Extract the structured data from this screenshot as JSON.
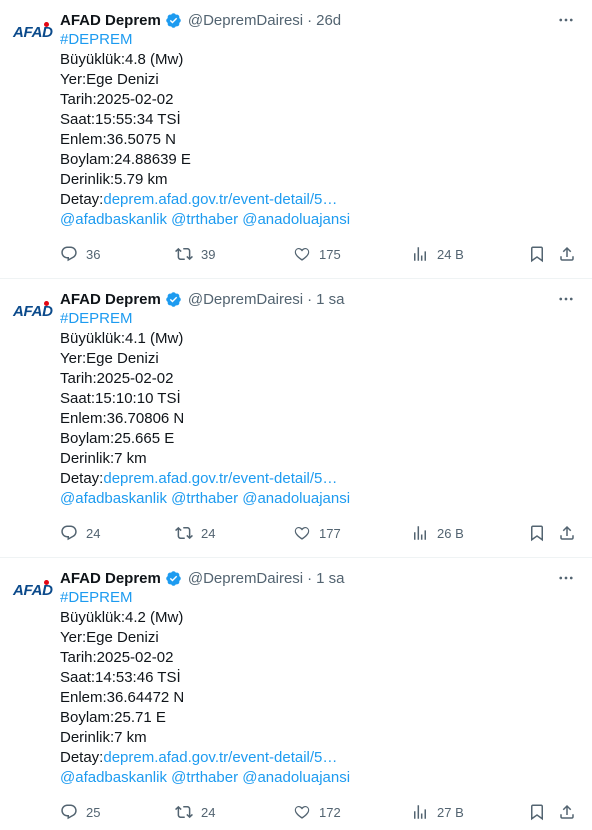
{
  "colors": {
    "link": "#1d9bf0",
    "muted": "#536471",
    "text": "#0f1419",
    "verified": "#1d9bf0",
    "logo_blue": "#0b4a8b",
    "logo_red": "#e30613"
  },
  "tweets": [
    {
      "avatar": "AFAD",
      "name": "AFAD Deprem",
      "handle": "@DepremDairesi",
      "sep": "·",
      "time": "26d",
      "hashtag": "#DEPREM",
      "lines": [
        "Büyüklük:4.8 (Mw)",
        "Yer:Ege Denizi",
        "Tarih:2025-02-02",
        "Saat:15:55:34 TSİ",
        "Enlem:36.5075 N",
        "Boylam:24.88639 E",
        "Derinlik:5.79 km"
      ],
      "detail_label": "Detay:",
      "detail_link": "deprem.afad.gov.tr/event-detail/5…",
      "mentions": [
        "@afadbaskanlik",
        "@trthaber",
        "@anadoluajansi"
      ],
      "replies": "36",
      "retweets": "39",
      "likes": "175",
      "views": "24 B"
    },
    {
      "avatar": "AFAD",
      "name": "AFAD Deprem",
      "handle": "@DepremDairesi",
      "sep": "·",
      "time": "1 sa",
      "hashtag": "#DEPREM",
      "lines": [
        "Büyüklük:4.1 (Mw)",
        "Yer:Ege Denizi",
        "Tarih:2025-02-02",
        "Saat:15:10:10 TSİ",
        "Enlem:36.70806 N",
        "Boylam:25.665 E",
        "Derinlik:7 km"
      ],
      "detail_label": "Detay:",
      "detail_link": "deprem.afad.gov.tr/event-detail/5…",
      "mentions": [
        "@afadbaskanlik",
        "@trthaber",
        "@anadoluajansi"
      ],
      "replies": "24",
      "retweets": "24",
      "likes": "177",
      "views": "26 B"
    },
    {
      "avatar": "AFAD",
      "name": "AFAD Deprem",
      "handle": "@DepremDairesi",
      "sep": "·",
      "time": "1 sa",
      "hashtag": "#DEPREM",
      "lines": [
        "Büyüklük:4.2 (Mw)",
        "Yer:Ege Denizi",
        "Tarih:2025-02-02",
        "Saat:14:53:46 TSİ",
        "Enlem:36.64472 N",
        "Boylam:25.71 E",
        "Derinlik:7 km"
      ],
      "detail_label": "Detay:",
      "detail_link": "deprem.afad.gov.tr/event-detail/5…",
      "mentions": [
        "@afadbaskanlik",
        "@trthaber",
        "@anadoluajansi"
      ],
      "replies": "25",
      "retweets": "24",
      "likes": "172",
      "views": "27 B"
    }
  ]
}
